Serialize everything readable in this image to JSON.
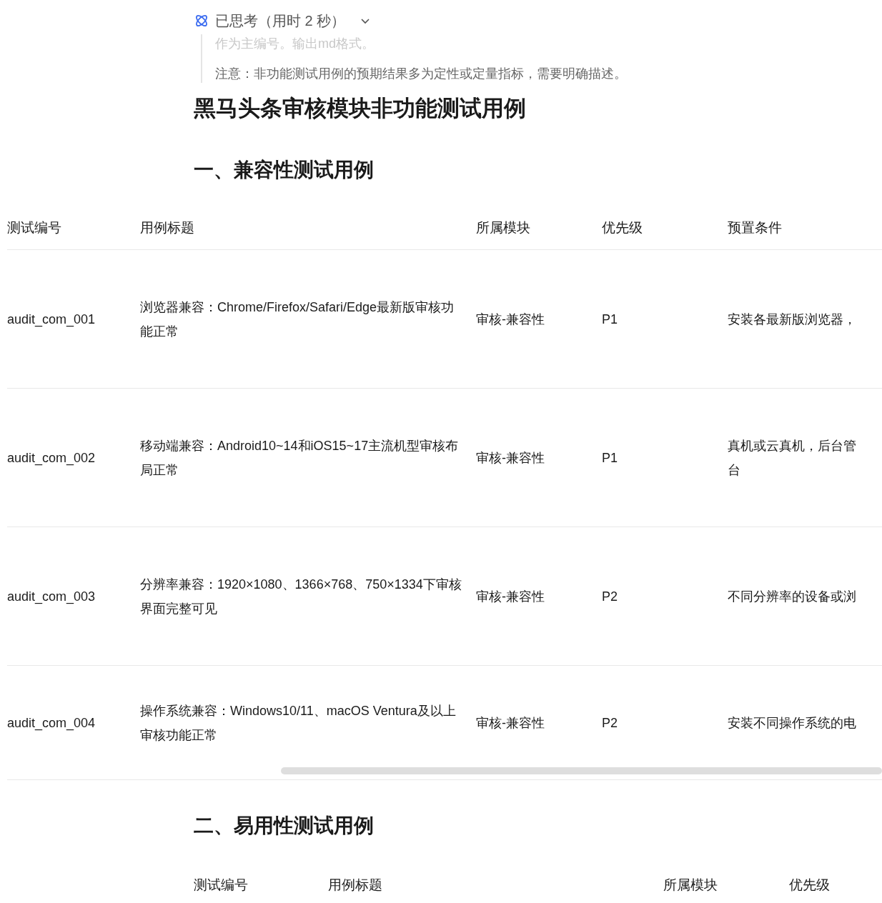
{
  "thinking": {
    "label": "已思考（用时 2 秒）",
    "expanded": true,
    "lines": [
      "作为主编号。输出md格式。",
      "注意：非功能测试用例的预期结果多为定性或定量指标，需要明确描述。"
    ]
  },
  "title": "黑马头条审核模块非功能测试用例",
  "sections": [
    {
      "heading": "一、兼容性测试用例",
      "columns": [
        "测试编号",
        "用例标题",
        "所属模块",
        "优先级",
        "预置条件"
      ],
      "rows": [
        [
          "audit_com_001",
          "浏览器兼容：Chrome/Firefox/Safari/Edge最新版审核功能正常",
          "审核-兼容性",
          "P1",
          "安装各最新版浏览器，"
        ],
        [
          "audit_com_002",
          "移动端兼容：Android10~14和iOS15~17主流机型审核布局正常",
          "审核-兼容性",
          "P1",
          "真机或云真机，后台管台"
        ],
        [
          "audit_com_003",
          "分辨率兼容：1920×1080、1366×768、750×1334下审核界面完整可见",
          "审核-兼容性",
          "P2",
          "不同分辨率的设备或浏"
        ],
        [
          "audit_com_004",
          "操作系统兼容：Windows10/11、macOS Ventura及以上审核功能正常",
          "审核-兼容性",
          "P2",
          "安装不同操作系统的电"
        ]
      ]
    },
    {
      "heading": "二、易用性测试用例",
      "columns": [
        "测试编号",
        "用例标题",
        "所属模块",
        "优先级"
      ]
    }
  ]
}
